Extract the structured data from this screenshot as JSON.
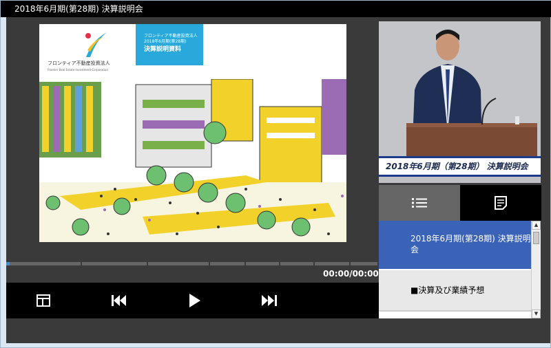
{
  "window": {
    "title": "2018年6月期(第28期)  決算説明会"
  },
  "slide": {
    "company_jp": "フロンティア不動産投資法人",
    "company_en": "Frontier Real Estate Investment Corporation",
    "box_line1": "フロンティア不動産投資法人",
    "box_line2": "2018年6月期(第28期)",
    "box_title": "決算説明資料"
  },
  "player": {
    "progress": 0.01,
    "time": "00:00/00:00",
    "controls": {
      "layout_icon": "layout-icon",
      "prev_icon": "skip-back-icon",
      "play_icon": "play-icon",
      "next_icon": "skip-forward-icon"
    }
  },
  "video": {
    "caption": "2018年6月期（第28期） 決算説明会"
  },
  "tabs": [
    {
      "icon": "list-icon",
      "active": true
    },
    {
      "icon": "document-icon",
      "active": false
    }
  ],
  "chapters": [
    {
      "label": "2018年6月期(第28期)  決算説明会",
      "active": true
    },
    {
      "label": "■決算及び業績予想",
      "active": false
    }
  ],
  "colors": {
    "accent": "#3a63b8",
    "slide_blue": "#29a8dc",
    "progress": "#3b8fd8"
  }
}
